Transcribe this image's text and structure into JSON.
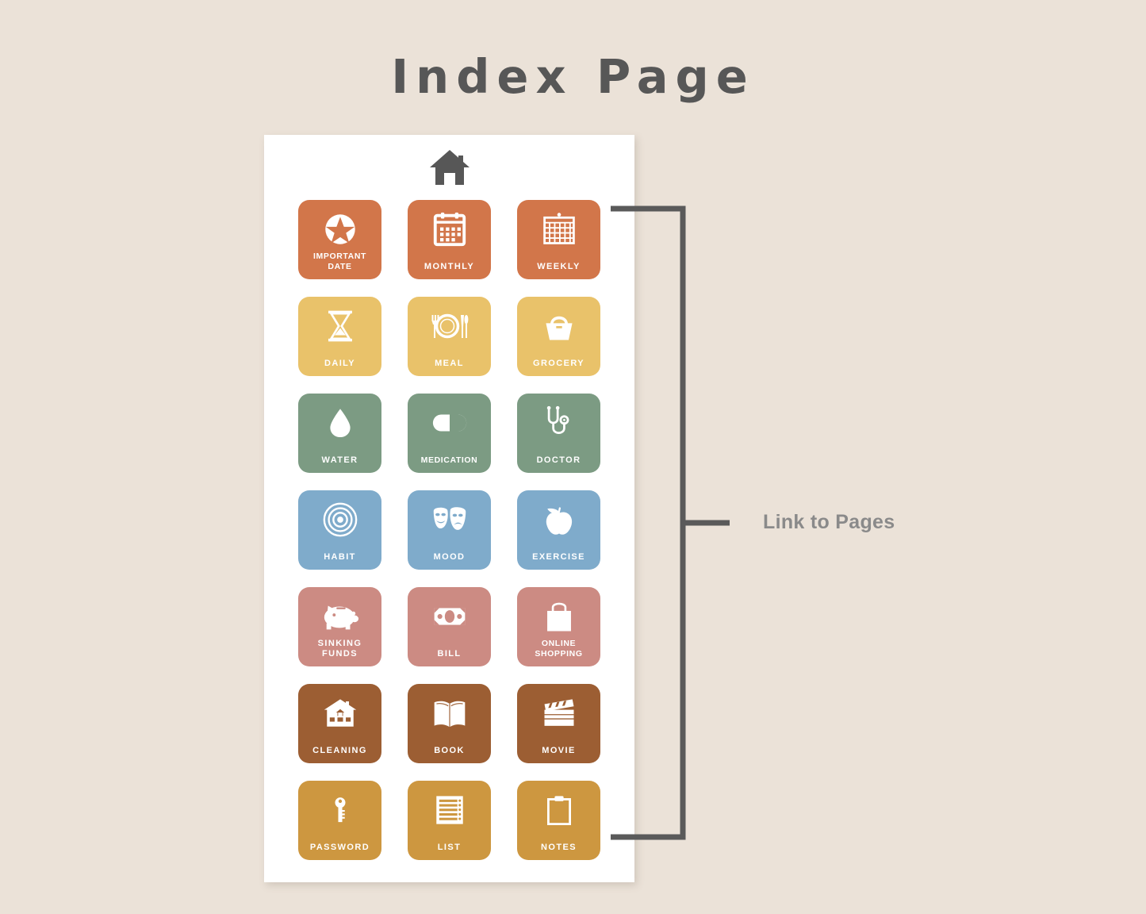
{
  "page": {
    "title": "Index Page",
    "background_color": "#ebe2d8",
    "title_color": "#575757"
  },
  "card": {
    "background_color": "#ffffff",
    "header_icon": "home-icon"
  },
  "annotation": {
    "label": "Link to Pages",
    "color": "#6e6e6e",
    "label_color": "#8a8a8a"
  },
  "palette": {
    "orange": "#d2764a",
    "yellow": "#e9c26a",
    "green": "#7c9b83",
    "blue": "#7fabcb",
    "rose": "#cc8b83",
    "brown": "#9c5e33",
    "gold": "#cd9740"
  },
  "tiles": [
    {
      "label": "IMPORTANT\nDATE",
      "icon": "star-badge-icon",
      "color": "#d2764a",
      "tight": true
    },
    {
      "label": "MONTHLY",
      "icon": "calendar-month-icon",
      "color": "#d2764a",
      "tight": false
    },
    {
      "label": "WEEKLY",
      "icon": "calendar-wall-icon",
      "color": "#d2764a",
      "tight": false
    },
    {
      "label": "DAILY",
      "icon": "hourglass-icon",
      "color": "#e9c26a",
      "tight": false
    },
    {
      "label": "MEAL",
      "icon": "plate-cutlery-icon",
      "color": "#e9c26a",
      "tight": false
    },
    {
      "label": "GROCERY",
      "icon": "shopping-basket-icon",
      "color": "#e9c26a",
      "tight": false
    },
    {
      "label": "WATER",
      "icon": "water-drop-icon",
      "color": "#7c9b83",
      "tight": false
    },
    {
      "label": "MEDICATION",
      "icon": "pill-capsule-icon",
      "color": "#7c9b83",
      "tight": true
    },
    {
      "label": "DOCTOR",
      "icon": "stethoscope-icon",
      "color": "#7c9b83",
      "tight": false
    },
    {
      "label": "HABIT",
      "icon": "target-rings-icon",
      "color": "#7fabcb",
      "tight": false
    },
    {
      "label": "MOOD",
      "icon": "theater-masks-icon",
      "color": "#7fabcb",
      "tight": false
    },
    {
      "label": "EXERCISE",
      "icon": "apple-icon",
      "color": "#7fabcb",
      "tight": false
    },
    {
      "label": "SINKING\nFUNDS",
      "icon": "piggy-bank-icon",
      "color": "#cc8b83",
      "tight": false
    },
    {
      "label": "BILL",
      "icon": "banknote-icon",
      "color": "#cc8b83",
      "tight": false
    },
    {
      "label": "ONLINE\nSHOPPING",
      "icon": "shopping-bag-icon",
      "color": "#cc8b83",
      "tight": true
    },
    {
      "label": "CLEANING",
      "icon": "house-icon",
      "color": "#9c5e33",
      "tight": false
    },
    {
      "label": "BOOK",
      "icon": "open-book-icon",
      "color": "#9c5e33",
      "tight": false
    },
    {
      "label": "MOVIE",
      "icon": "clapperboard-icon",
      "color": "#9c5e33",
      "tight": false
    },
    {
      "label": "PASSWORD",
      "icon": "key-icon",
      "color": "#cd9740",
      "tight": false
    },
    {
      "label": "LIST",
      "icon": "checklist-icon",
      "color": "#cd9740",
      "tight": false
    },
    {
      "label": "NOTES",
      "icon": "clipboard-icon",
      "color": "#cd9740",
      "tight": false
    }
  ]
}
